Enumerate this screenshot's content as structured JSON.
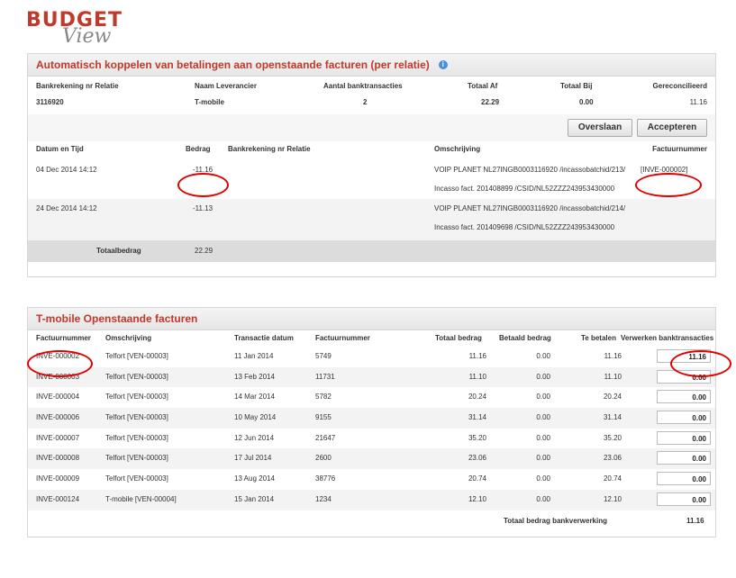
{
  "logo": {
    "top": "BUDGET",
    "bottom": "View"
  },
  "panel1": {
    "title": "Automatisch koppelen van betalingen aan openstaande facturen (per relatie)",
    "summary_headers": [
      "Bankrekening nr Relatie",
      "Naam Leverancier",
      "Aantal banktransacties",
      "Totaal Af",
      "Totaal Bij",
      "Gereconcilieerd"
    ],
    "summary_values": [
      "3116920",
      "T-mobile",
      "2",
      "22.29",
      "0.00",
      "11.16"
    ],
    "buttons": {
      "skip": "Overslaan",
      "accept": "Accepteren"
    },
    "tx_headers": [
      "Datum en Tijd",
      "Bedrag",
      "Bankrekening nr Relatie",
      "Omschrijving",
      "Factuurnummer"
    ],
    "transactions": [
      {
        "date": "04 Dec 2014 14:12",
        "amount": "-11.16",
        "desc1": "VOIP PLANET NL27INGB0003116920 /incassobatchid/213/",
        "desc2": "Incasso fact. 201408899 /CSID/NL52ZZZ243953430000",
        "invoice": "[INVE-000002]"
      },
      {
        "date": "24 Dec 2014 14:12",
        "amount": "-11.13",
        "desc1": "VOIP PLANET NL27INGB0003116920 /incassobatchid/214/",
        "desc2": "Incasso fact. 201409698 /CSID/NL52ZZZ243953430000",
        "invoice": ""
      }
    ],
    "total_label": "Totaalbedrag",
    "total_value": "22.29"
  },
  "panel2": {
    "title": "T-mobile Openstaande facturen",
    "headers": [
      "Factuurnummer",
      "Omschrijving",
      "Transactie datum",
      "Factuurnummer",
      "Totaal bedrag",
      "Betaald bedrag",
      "Te betalen",
      "Verwerken banktransacties"
    ],
    "rows": [
      [
        "INVE-000002",
        "Telfort [VEN-00003]",
        "11 Jan 2014",
        "5749",
        "11.16",
        "0.00",
        "11.16",
        "11.16"
      ],
      [
        "INVE-000003",
        "Telfort [VEN-00003]",
        "13 Feb 2014",
        "11731",
        "11.10",
        "0.00",
        "11.10",
        "0.00"
      ],
      [
        "INVE-000004",
        "Telfort [VEN-00003]",
        "14 Mar 2014",
        "5782",
        "20.24",
        "0.00",
        "20.24",
        "0.00"
      ],
      [
        "INVE-000006",
        "Telfort [VEN-00003]",
        "10 May 2014",
        "9155",
        "31.14",
        "0.00",
        "31.14",
        "0.00"
      ],
      [
        "INVE-000007",
        "Telfort [VEN-00003]",
        "12 Jun 2014",
        "21647",
        "35.20",
        "0.00",
        "35.20",
        "0.00"
      ],
      [
        "INVE-000008",
        "Telfort [VEN-00003]",
        "17 Jul 2014",
        "2600",
        "23.06",
        "0.00",
        "23.06",
        "0.00"
      ],
      [
        "INVE-000009",
        "Telfort [VEN-00003]",
        "13 Aug 2014",
        "38776",
        "20.74",
        "0.00",
        "20.74",
        "0.00"
      ],
      [
        "INVE-000124",
        "T-mobile [VEN-00004]",
        "15 Jan 2014",
        "1234",
        "12.10",
        "0.00",
        "12.10",
        "0.00"
      ]
    ],
    "footer_label": "Totaal bedrag bankverwerking",
    "footer_value": "11.16"
  }
}
